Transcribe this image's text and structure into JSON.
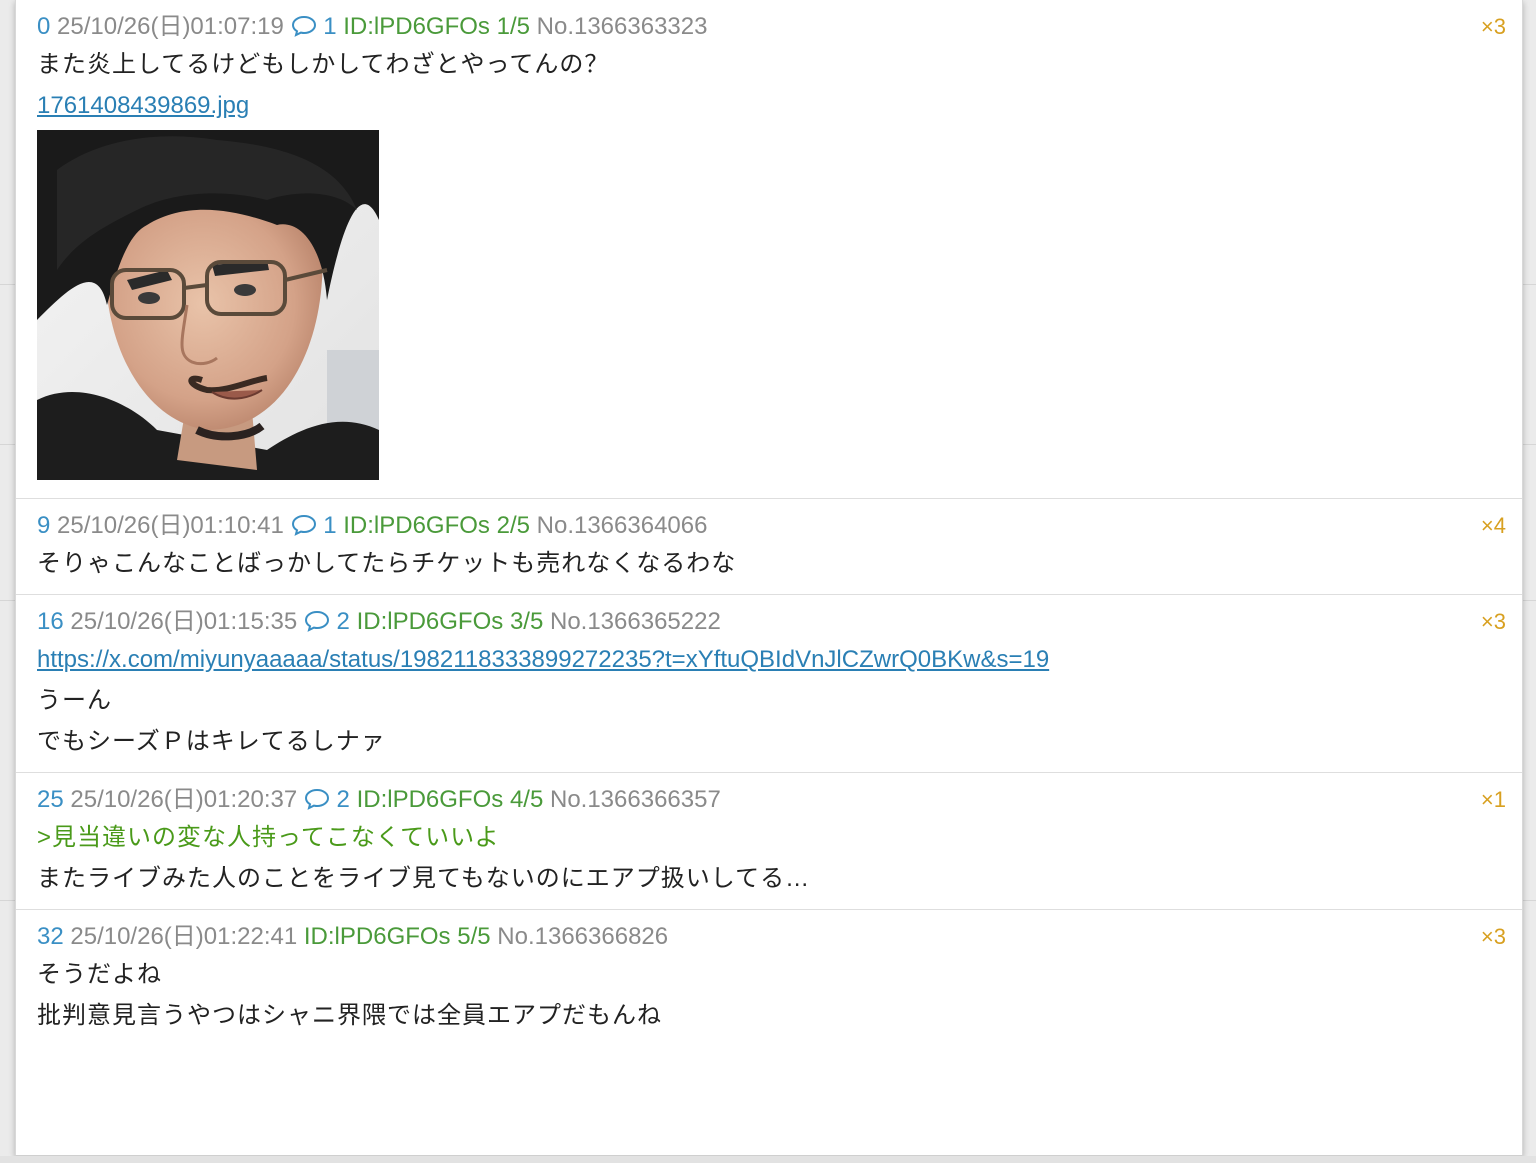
{
  "posts": [
    {
      "num": "0",
      "date": "25/10/26(日)01:07:19",
      "replies": "1",
      "id": "ID:lPD6GFOs",
      "id_count": "1/5",
      "no": "No.1366363323",
      "likes": "×3",
      "lines": [
        "また炎上してるけどもしかしてわざとやってんの？"
      ],
      "file": "1761408439869.jpg",
      "has_image": true
    },
    {
      "num": "9",
      "date": "25/10/26(日)01:10:41",
      "replies": "1",
      "id": "ID:lPD6GFOs",
      "id_count": "2/5",
      "no": "No.1366364066",
      "likes": "×4",
      "lines": [
        "そりゃこんなことばっかしてたらチケットも売れなくなるわな"
      ]
    },
    {
      "num": "16",
      "date": "25/10/26(日)01:15:35",
      "replies": "2",
      "id": "ID:lPD6GFOs",
      "id_count": "3/5",
      "no": "No.1366365222",
      "likes": "×3",
      "url": "https://x.com/miyunyaaaaa/status/1982118333899272235?t=xYftuQBIdVnJlCZwrQ0BKw&s=19",
      "lines": [
        "うーん",
        "でもシーズＰはキレてるしナァ"
      ]
    },
    {
      "num": "25",
      "date": "25/10/26(日)01:20:37",
      "replies": "2",
      "id": "ID:lPD6GFOs",
      "id_count": "4/5",
      "no": "No.1366366357",
      "likes": "×1",
      "quote": ">見当違いの変な人持ってこなくていいよ",
      "lines": [
        "またライブみた人のことをライブ見てもないのにエアプ扱いしてる…"
      ]
    },
    {
      "num": "32",
      "date": "25/10/26(日)01:22:41",
      "id": "ID:lPD6GFOs",
      "id_count": "5/5",
      "no": "No.1366366826",
      "likes": "×3",
      "lines": [
        "そうだよね",
        "批判意見言うやつはシャニ界隈では全員エアプだもんね"
      ]
    }
  ],
  "colors": {
    "res_num": "#3a8fc4",
    "id": "#4a9a3a",
    "like": "#d8a020",
    "link": "#2a7fb4",
    "quote": "#4a9a1a"
  },
  "icons": {
    "reply": "speech-bubble-icon"
  }
}
